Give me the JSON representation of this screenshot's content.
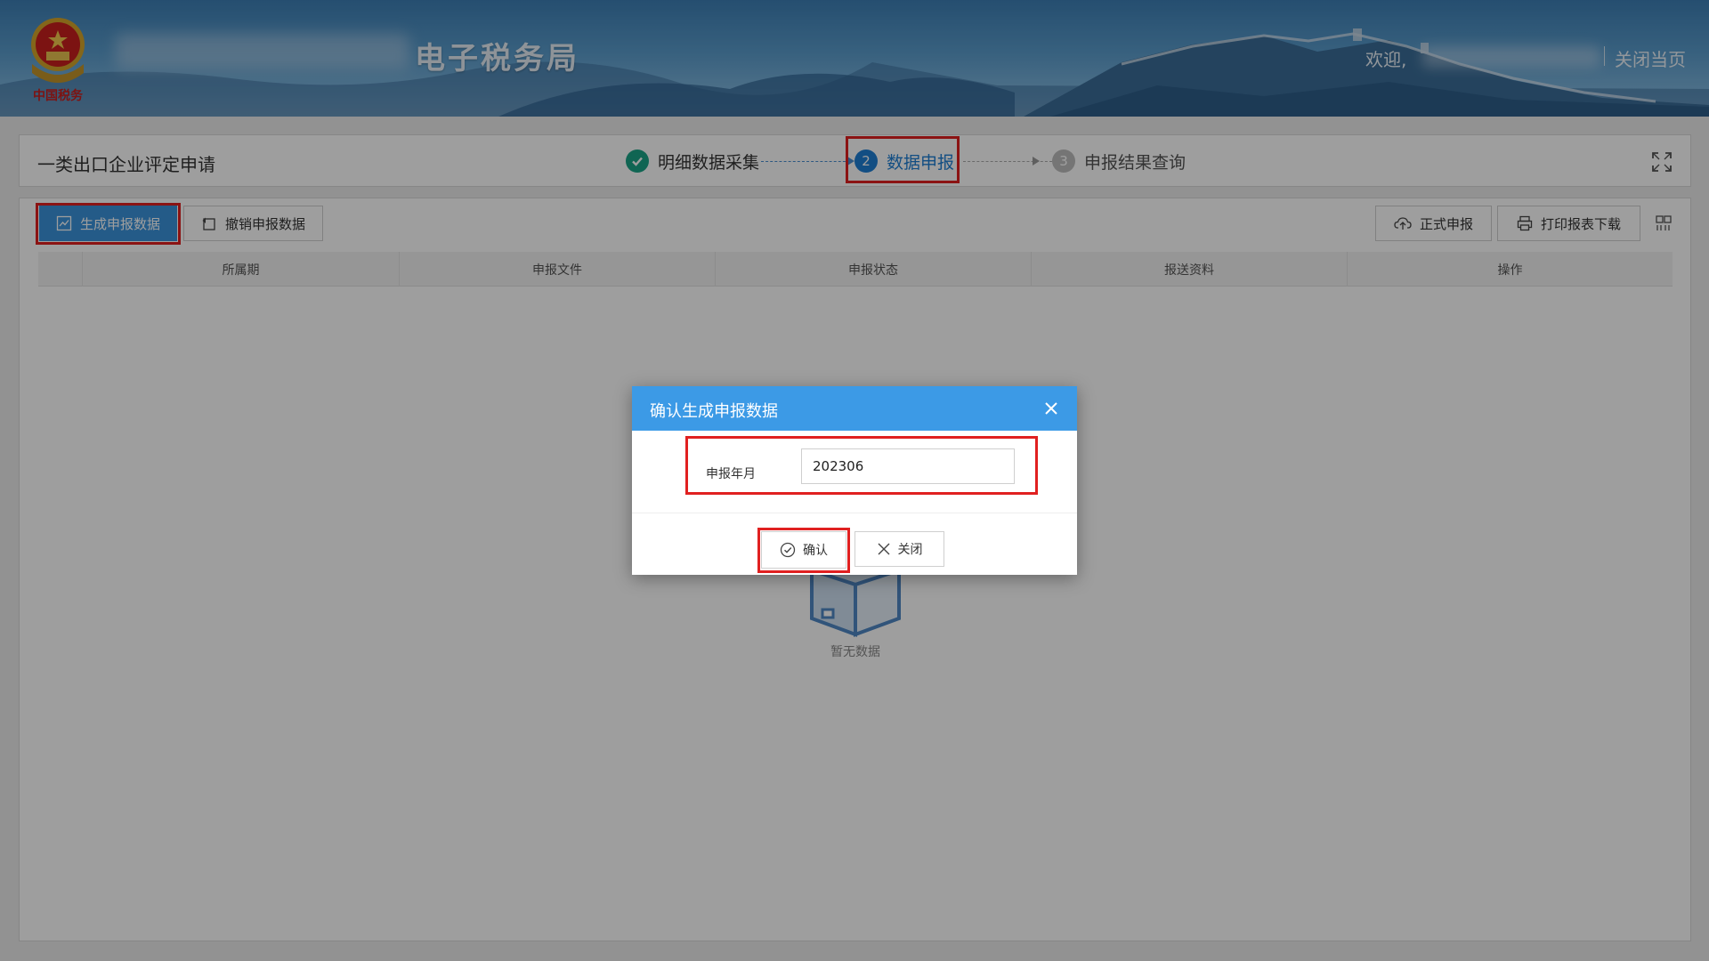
{
  "header": {
    "site_title": "电子税务局",
    "welcome": "欢迎,",
    "close_page": "关闭当页",
    "emblem_text": "中国税务"
  },
  "stepbar": {
    "page_title": "一类出口企业评定申请",
    "steps": [
      {
        "number": "✓",
        "label": "明细数据采集",
        "state": "done"
      },
      {
        "number": "2",
        "label": "数据申报",
        "state": "active"
      },
      {
        "number": "3",
        "label": "申报结果查询",
        "state": "pending"
      }
    ]
  },
  "toolbar": {
    "generate_label": "生成申报数据",
    "revoke_label": "撤销申报数据",
    "submit_label": "正式申报",
    "print_label": "打印报表下载"
  },
  "table": {
    "columns": [
      "所属期",
      "申报文件",
      "申报状态",
      "报送资料",
      "操作"
    ],
    "empty_text": "暂无数据"
  },
  "dialog": {
    "title": "确认生成申报数据",
    "field_label": "申报年月",
    "field_value": "202306",
    "confirm_label": "确认",
    "close_label": "关闭"
  },
  "colors": {
    "primary": "#3b94dc",
    "dialog_header": "#3c9ae6",
    "step_done": "#1aa386",
    "step_active": "#1e7ed3",
    "highlight": "#e02020"
  }
}
